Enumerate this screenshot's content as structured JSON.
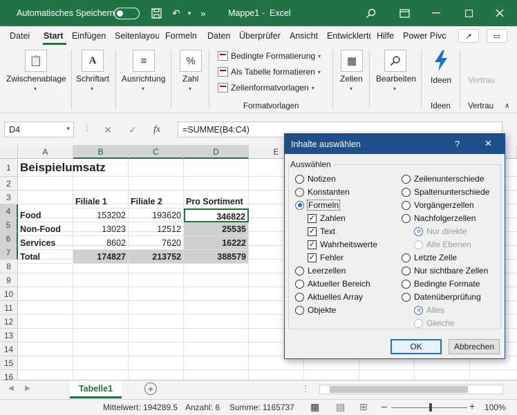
{
  "titlebar": {
    "autosave_label": "Automatisches Speichern",
    "document": "Mappe1",
    "separator": "-",
    "app": "Excel",
    "more": "»"
  },
  "tabs": [
    "Datei",
    "Start",
    "Einfügen",
    "Seitenlayou",
    "Formeln",
    "Daten",
    "Überprüfer",
    "Ansicht",
    "Entwicklerto",
    "Hilfe",
    "Power Pivc"
  ],
  "active_tab": "Start",
  "ribbon": {
    "zwischenablage": "Zwischenablage",
    "schriftart": "Schriftart",
    "ausrichtung": "Ausrichtung",
    "zahl": "Zahl",
    "zahl_icon": "%",
    "bedingte": "Bedingte Formatierung",
    "als_tabelle": "Als Tabelle formatieren",
    "zellenformat": "Zellenformatvorlagen",
    "formatvorlagen": "Formatvorlagen",
    "zellen": "Zellen",
    "bearbeiten": "Bearbeiten",
    "ideen": "Ideen",
    "ideen_group": "Ideen",
    "vertrau": "Vertrau",
    "vertrau_group": "Vertrau"
  },
  "formula_bar": {
    "name_box": "D4",
    "fx": "fx",
    "formula": "=SUMME(B4:C4)"
  },
  "sheet": {
    "columns": [
      "A",
      "B",
      "C",
      "D",
      "E"
    ],
    "rows": [
      "1",
      "2",
      "3",
      "4",
      "5",
      "6",
      "7",
      "8",
      "9",
      "10",
      "11",
      "12",
      "13",
      "14",
      "15",
      "16"
    ],
    "title": "Beispielumsatz",
    "headers": [
      "Filiale 1",
      "Filiale 2",
      "Pro Sortiment"
    ],
    "data": [
      [
        "Food",
        "153202",
        "193620",
        "346822"
      ],
      [
        "Non-Food",
        "13023",
        "12512",
        "25535"
      ],
      [
        "Services",
        "8602",
        "7620",
        "16222"
      ],
      [
        "Total",
        "174827",
        "213752",
        "388579"
      ]
    ]
  },
  "sheet_tab": "Tabelle1",
  "status": {
    "mittelwert": "Mittelwert: 194289.5",
    "anzahl": "Anzahl: 6",
    "summe": "Summe: 1165737",
    "zoom": "100%",
    "minus": "–",
    "plus": "+"
  },
  "dialog": {
    "title": "Inhalte auswählen",
    "help": "?",
    "close": "✕",
    "group": "Auswählen",
    "left": [
      {
        "label": "Notizen",
        "type": "radio",
        "checked": false,
        "disabled": false
      },
      {
        "label": "Konstanten",
        "type": "radio",
        "checked": false,
        "disabled": false
      },
      {
        "label": "Formeln",
        "type": "radio",
        "checked": true,
        "disabled": false
      },
      {
        "label": "Zahlen",
        "type": "check",
        "checked": true,
        "disabled": false
      },
      {
        "label": "Text",
        "type": "check",
        "checked": true,
        "disabled": false
      },
      {
        "label": "Wahrheitswerte",
        "type": "check",
        "checked": true,
        "disabled": false
      },
      {
        "label": "Fehler",
        "type": "check",
        "checked": true,
        "disabled": false
      },
      {
        "label": "Leerzellen",
        "type": "radio",
        "checked": false,
        "disabled": false
      },
      {
        "label": "Aktueller Bereich",
        "type": "radio",
        "checked": false,
        "disabled": false
      },
      {
        "label": "Aktuelles Array",
        "type": "radio",
        "checked": false,
        "disabled": false
      },
      {
        "label": "Objekte",
        "type": "radio",
        "checked": false,
        "disabled": false
      }
    ],
    "right": [
      {
        "label": "Zeilenunterschiede",
        "type": "radio",
        "checked": false,
        "disabled": false
      },
      {
        "label": "Spaltenunterschiede",
        "type": "radio",
        "checked": false,
        "disabled": false
      },
      {
        "label": "Vorgängerzellen",
        "type": "radio",
        "checked": false,
        "disabled": false
      },
      {
        "label": "Nachfolgerzellen",
        "type": "radio",
        "checked": false,
        "disabled": false
      },
      {
        "label": "Nur direkte",
        "type": "radio",
        "checked": true,
        "disabled": true
      },
      {
        "label": "Alle Ebenen",
        "type": "radio",
        "checked": false,
        "disabled": true
      },
      {
        "label": "Letzte Zelle",
        "type": "radio",
        "checked": false,
        "disabled": false
      },
      {
        "label": "Nur sichtbare Zellen",
        "type": "radio",
        "checked": false,
        "disabled": false
      },
      {
        "label": "Bedingte Formate",
        "type": "radio",
        "checked": false,
        "disabled": false
      },
      {
        "label": "Datenüberprüfung",
        "type": "radio",
        "checked": false,
        "disabled": false
      },
      {
        "label": "Alles",
        "type": "radio",
        "checked": true,
        "disabled": true
      },
      {
        "label": "Gleiche",
        "type": "radio",
        "checked": false,
        "disabled": true
      }
    ],
    "ok": "OK",
    "cancel": "Abbrechen"
  },
  "colors": {
    "excel_green": "#217346",
    "dialog_blue": "#1f4e8c",
    "highlight": "#cfcfcf"
  }
}
